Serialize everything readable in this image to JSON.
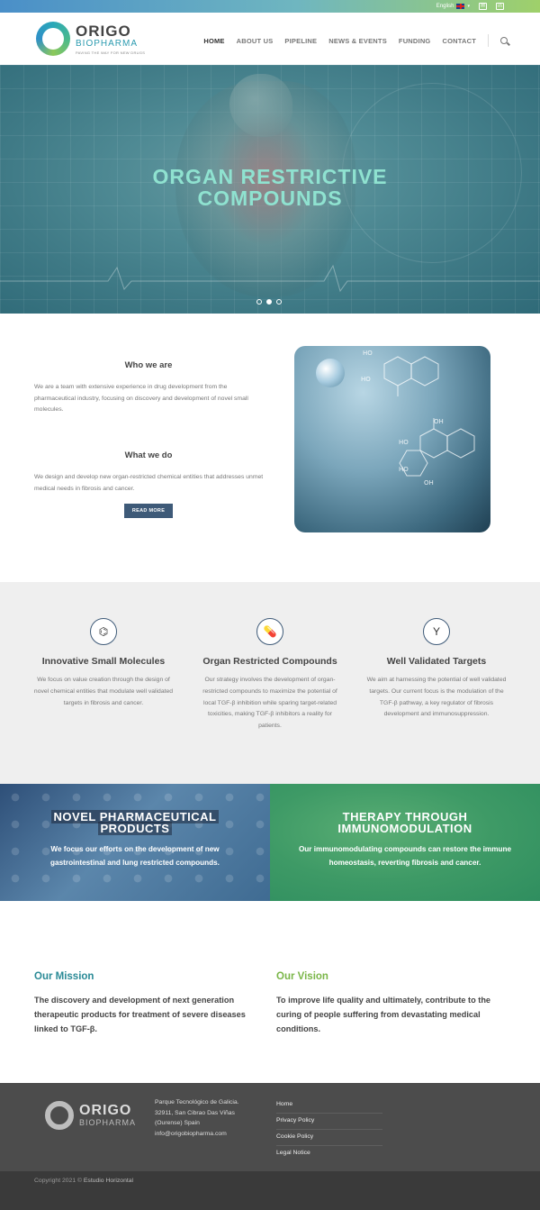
{
  "topbar": {
    "language": "English",
    "icons": [
      "mail-icon",
      "linkedin-icon"
    ]
  },
  "logo": {
    "name": "ORIGO",
    "sub": "BIOPHARMA",
    "tagline": "PAVING THE WAY FOR NEW DRUGS"
  },
  "nav": {
    "items": [
      "HOME",
      "ABOUT US",
      "PIPELINE",
      "NEWS & EVENTS",
      "FUNDING",
      "CONTACT"
    ],
    "active": "HOME"
  },
  "hero": {
    "title_line1": "ORGAN RESTRICTIVE",
    "title_line2": "COMPOUNDS",
    "slides": 3,
    "active_slide": 2
  },
  "about": {
    "who_title": "Who we are",
    "who_text": "We are a team with extensive experience in drug development from the pharmaceutical industry, focusing on discovery and development of novel small molecules.",
    "what_title": "What we do",
    "what_text": "We design and develop new organ-restricted chemical entities that addresses unmet medical needs in fibrosis and cancer.",
    "button": "READ MORE"
  },
  "features": [
    {
      "icon": "molecule-icon",
      "title": "Innovative Small Molecules",
      "text": "We focus on value creation through the design of novel chemical entities that modulate well validated targets in fibrosis and cancer."
    },
    {
      "icon": "pill-icon",
      "title": "Organ Restricted Compounds",
      "text": "Our strategy involves the development of organ-restricted compounds to maximize the potential of local TGF-β inhibition while sparing target-related toxicities, making TGF-β inhibitors a reality for patients."
    },
    {
      "icon": "antibody-icon",
      "title": "Well Validated Targets",
      "text": "We aim at harnessing the potential of well validated targets. Our current focus is the modulation of the TGF-β pathway, a key regulator of fibrosis development and immunosuppression."
    }
  ],
  "banners": [
    {
      "title_line1": "NOVEL PHARMACEUTICAL",
      "title_line2": "PRODUCTS",
      "text": "We focus our efforts on the development of new gastrointestinal and lung restricted compounds."
    },
    {
      "title_line1": "THERAPY THROUGH",
      "title_line2": "IMMUNOMODULATION",
      "text": "Our immunomodulating compounds can restore the immune homeostasis, reverting fibrosis and cancer."
    }
  ],
  "mission": {
    "title": "Our Mission",
    "text": "The discovery and development of next generation therapeutic products for treatment of severe diseases linked to TGF-β.",
    "color": "#2a8a96"
  },
  "vision": {
    "title": "Our Vision",
    "text": "To improve life quality and ultimately, contribute to the curing of people suffering from devastating medical conditions.",
    "color": "#7ab648"
  },
  "footer": {
    "logo_name": "ORIGO",
    "logo_sub": "BIOPHARMA",
    "address": [
      "Parque Tecnológico de Galicia.",
      "32911, San Cibrao Das Viñas",
      "(Ourense) Spain",
      "info@origobiopharma.com"
    ],
    "links": [
      "Home",
      "Privacy Policy",
      "Cookie Policy",
      "Legal Notice"
    ],
    "copyright": "Copyright 2021 ©",
    "credit": "Estudio Horizontal"
  },
  "colors": {
    "accent": "#3e5a78",
    "hero_title": "#8fe2d0",
    "footer_bg": "#4c4c4c"
  }
}
